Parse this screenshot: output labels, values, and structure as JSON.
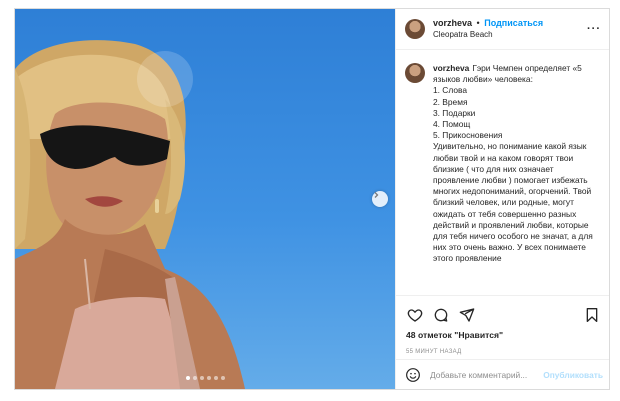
{
  "post": {
    "username": "vorzheva",
    "separator": "•",
    "follow_label": "Подписаться",
    "location": "Cleopatra Beach",
    "more_icon": "more-horizontal-icon"
  },
  "caption": {
    "username": "vorzheva",
    "lines": [
      "Гэри Чемпен определяет «5 языков любви» человека:",
      "1. Слова",
      "2. Время",
      "3. Подарки",
      "4. Помощ",
      "5. Прикосновения",
      "Удивительно, но понимание какой язык любви твой и на каком говорят твои близкие ( что для них означает проявление любви ) помогает избежать многих недопониманий, огорчений. Твой близкий человек, или родные, могут ожидать от тебя совершенно разных действий и проявлений любви, которые для тебя ничего особого не значат, а для них это очень важно. У всех понимаете этого проявление"
    ]
  },
  "actions": {
    "likes_text": "48 отметок \"Нравится\"",
    "time_text": "55 МИНУТ НАЗАД",
    "icons": [
      "heart-icon",
      "comment-icon",
      "share-icon",
      "bookmark-icon"
    ]
  },
  "comment_box": {
    "placeholder": "Добавьте комментарий...",
    "post_label": "Опубликовать",
    "emoji_icon": "smiley-icon"
  },
  "carousel": {
    "total": 6,
    "active_index": 0
  },
  "colors": {
    "accent": "#0095f6",
    "post_disabled": "#b2dffc",
    "sky": "#3f92e3"
  }
}
